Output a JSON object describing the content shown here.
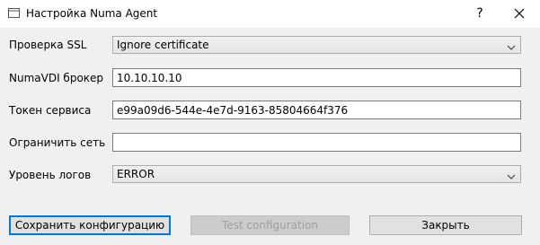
{
  "window": {
    "title": "Настройка Numa Agent",
    "help_label": "?",
    "icons": {
      "app": "window-icon",
      "close": "close-icon"
    }
  },
  "form": {
    "ssl": {
      "label": "Проверка SSL",
      "value": "Ignore certificate"
    },
    "broker": {
      "label": "NumaVDI брокер",
      "value": "10.10.10.10"
    },
    "token": {
      "label": "Токен сервиса",
      "value": "e99a09d6-544e-4e7d-9163-85804664f376"
    },
    "network": {
      "label": "Ограничить сеть",
      "value": ""
    },
    "log_level": {
      "label": "Уровень логов",
      "value": "ERROR"
    }
  },
  "buttons": {
    "save": "Сохранить конфигурацию",
    "test": "Test configuration",
    "close": "Закрыть"
  },
  "colors": {
    "focus_border": "#0078d7",
    "disabled_text": "#a0a0a0"
  }
}
